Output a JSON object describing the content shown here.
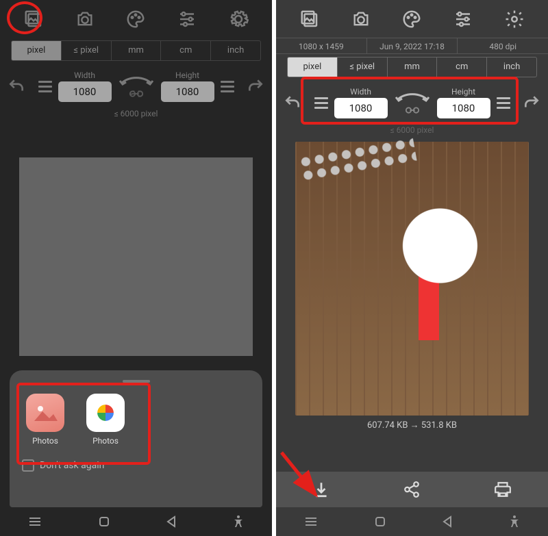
{
  "units": [
    "pixel",
    "≤ pixel",
    "mm",
    "cm",
    "inch"
  ],
  "active_unit": "pixel",
  "dim": {
    "width_label": "Width",
    "height_label": "Height",
    "width_value": "1080",
    "height_value": "1080",
    "limit": "≤ 6000 pixel"
  },
  "sheet": {
    "app1_label": "Photos",
    "app2_label": "Photos",
    "dont_ask": "Don't ask again"
  },
  "right_info": {
    "res": "1080 x 1459",
    "date": "Jun 9, 2022 17:18",
    "dpi": "480 dpi"
  },
  "right_size": "607.74 KB → 531.8 KB"
}
